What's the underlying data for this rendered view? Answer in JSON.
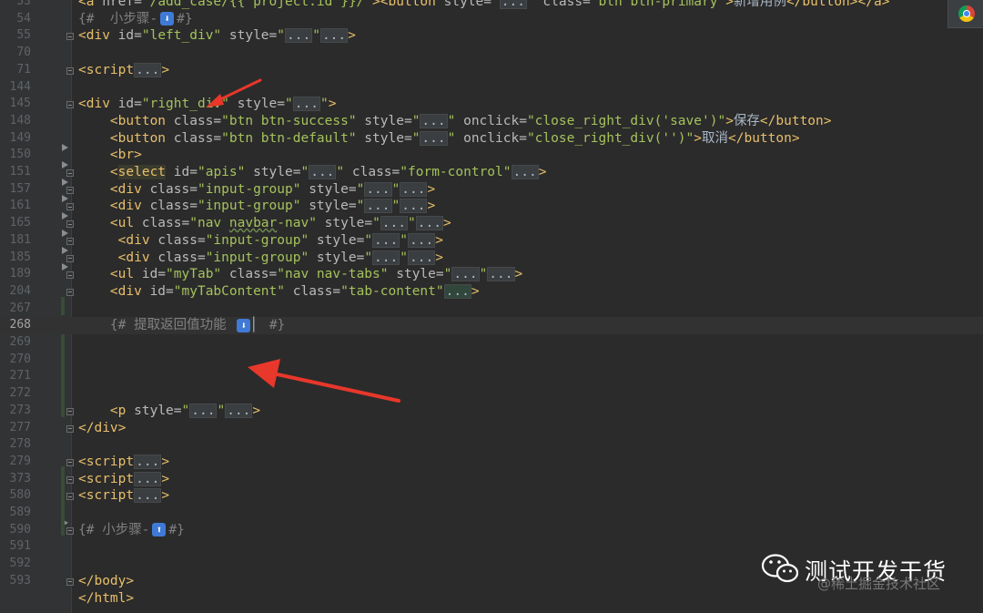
{
  "editor": {
    "colors": {
      "background": "#2b2b2b",
      "gutter": "#313335",
      "tag": "#e8bf6a",
      "string": "#a5c25c",
      "comment": "#808080",
      "change_bar": "#384c38"
    },
    "lines": [
      {
        "n": "53",
        "segments": [
          {
            "c": "tag",
            "t": "<a "
          },
          {
            "c": "attr",
            "t": "href="
          },
          {
            "c": "str",
            "t": "\"/add_case/{{ project.id }}/\""
          },
          {
            "c": "tag",
            "t": ">"
          },
          {
            "c": "tag",
            "t": "<button "
          },
          {
            "c": "attr",
            "t": "style="
          },
          {
            "c": "str",
            "t": "\""
          },
          {
            "c": "fold",
            "t": "..."
          },
          {
            "c": "str",
            "t": "\" "
          },
          {
            "c": "attr",
            "t": "class="
          },
          {
            "c": "str",
            "t": "\"btn btn-primary\""
          },
          {
            "c": "tag",
            "t": ">"
          },
          {
            "c": "txt",
            "t": "新增用例"
          },
          {
            "c": "tag",
            "t": "</button></a>"
          }
        ]
      },
      {
        "n": "54",
        "segments": [
          {
            "c": "cmt",
            "t": "{#  小步骤-"
          },
          {
            "c": "emoji",
            "t": "⬇"
          },
          {
            "c": "cmt",
            "t": "#}"
          }
        ]
      },
      {
        "n": "55",
        "segments": [
          {
            "c": "tag",
            "t": "<div "
          },
          {
            "c": "attr",
            "t": "id="
          },
          {
            "c": "str",
            "t": "\"left_div\" "
          },
          {
            "c": "attr",
            "t": "style="
          },
          {
            "c": "str",
            "t": "\""
          },
          {
            "c": "fold",
            "t": "..."
          },
          {
            "c": "str",
            "t": "\""
          },
          {
            "c": "fold-plain",
            "t": "..."
          },
          {
            "c": "tag",
            "t": ">"
          }
        ]
      },
      {
        "n": "70",
        "segments": []
      },
      {
        "n": "71",
        "segments": [
          {
            "c": "tag",
            "t": "<script"
          },
          {
            "c": "fold",
            "t": "..."
          },
          {
            "c": "tag",
            "t": ">"
          }
        ]
      },
      {
        "n": "144",
        "segments": []
      },
      {
        "n": "145",
        "segments": [
          {
            "c": "tag",
            "t": "<div "
          },
          {
            "c": "attr",
            "t": "id="
          },
          {
            "c": "str",
            "t": "\"right_div\" "
          },
          {
            "c": "attr",
            "t": "style="
          },
          {
            "c": "str",
            "t": "\""
          },
          {
            "c": "fold",
            "t": "..."
          },
          {
            "c": "str",
            "t": "\""
          },
          {
            "c": "tag",
            "t": ">"
          }
        ]
      },
      {
        "n": "148",
        "segments": [
          {
            "c": "txt",
            "t": "    "
          },
          {
            "c": "tag",
            "t": "<button "
          },
          {
            "c": "attr",
            "t": "class="
          },
          {
            "c": "str",
            "t": "\"btn btn-success\" "
          },
          {
            "c": "attr",
            "t": "style="
          },
          {
            "c": "str",
            "t": "\""
          },
          {
            "c": "fold",
            "t": "..."
          },
          {
            "c": "str",
            "t": "\" "
          },
          {
            "c": "attr",
            "t": "onclick="
          },
          {
            "c": "str",
            "t": "\"close_right_div('save')\""
          },
          {
            "c": "tag",
            "t": ">"
          },
          {
            "c": "txt",
            "t": "保存"
          },
          {
            "c": "tag",
            "t": "</button>"
          }
        ]
      },
      {
        "n": "149",
        "segments": [
          {
            "c": "txt",
            "t": "    "
          },
          {
            "c": "tag",
            "t": "<button "
          },
          {
            "c": "attr",
            "t": "class="
          },
          {
            "c": "str",
            "t": "\"btn btn-default\" "
          },
          {
            "c": "attr",
            "t": "style="
          },
          {
            "c": "str",
            "t": "\""
          },
          {
            "c": "fold",
            "t": "..."
          },
          {
            "c": "str",
            "t": "\" "
          },
          {
            "c": "attr",
            "t": "onclick="
          },
          {
            "c": "str",
            "t": "\"close_right_div('')\""
          },
          {
            "c": "tag",
            "t": ">"
          },
          {
            "c": "txt",
            "t": "取消"
          },
          {
            "c": "tag",
            "t": "</button>"
          }
        ]
      },
      {
        "n": "150",
        "segments": [
          {
            "c": "txt",
            "t": "    "
          },
          {
            "c": "tag",
            "t": "<br>"
          }
        ]
      },
      {
        "n": "151",
        "segments": [
          {
            "c": "txt",
            "t": "    "
          },
          {
            "c": "tag",
            "t": "<"
          },
          {
            "c": "tag-hl",
            "t": "select"
          },
          {
            "c": "tag",
            "t": " "
          },
          {
            "c": "attr",
            "t": "id="
          },
          {
            "c": "str",
            "t": "\"apis\" "
          },
          {
            "c": "attr",
            "t": "style="
          },
          {
            "c": "str",
            "t": "\""
          },
          {
            "c": "fold",
            "t": "..."
          },
          {
            "c": "str",
            "t": "\" "
          },
          {
            "c": "attr",
            "t": "class="
          },
          {
            "c": "str",
            "t": "\"form-control\""
          },
          {
            "c": "fold-plain",
            "t": "..."
          },
          {
            "c": "tag",
            "t": ">"
          }
        ]
      },
      {
        "n": "157",
        "segments": [
          {
            "c": "txt",
            "t": "    "
          },
          {
            "c": "tag",
            "t": "<div "
          },
          {
            "c": "attr",
            "t": "class="
          },
          {
            "c": "str",
            "t": "\"input-group\" "
          },
          {
            "c": "attr",
            "t": "style="
          },
          {
            "c": "str",
            "t": "\""
          },
          {
            "c": "fold",
            "t": "..."
          },
          {
            "c": "str",
            "t": "\""
          },
          {
            "c": "fold",
            "t": "..."
          },
          {
            "c": "tag",
            "t": ">"
          }
        ]
      },
      {
        "n": "161",
        "segments": [
          {
            "c": "txt",
            "t": "    "
          },
          {
            "c": "tag",
            "t": "<div "
          },
          {
            "c": "attr",
            "t": "class="
          },
          {
            "c": "str",
            "t": "\"input-group\" "
          },
          {
            "c": "attr",
            "t": "style="
          },
          {
            "c": "str",
            "t": "\""
          },
          {
            "c": "fold",
            "t": "..."
          },
          {
            "c": "str",
            "t": "\""
          },
          {
            "c": "fold",
            "t": "..."
          },
          {
            "c": "tag",
            "t": ">"
          }
        ]
      },
      {
        "n": "165",
        "segments": [
          {
            "c": "txt",
            "t": "    "
          },
          {
            "c": "tag",
            "t": "<ul "
          },
          {
            "c": "attr",
            "t": "class="
          },
          {
            "c": "str",
            "t": "\"nav "
          },
          {
            "c": "str-und",
            "t": "navbar"
          },
          {
            "c": "str",
            "t": "-nav\" "
          },
          {
            "c": "attr",
            "t": "style="
          },
          {
            "c": "str",
            "t": "\""
          },
          {
            "c": "fold",
            "t": "..."
          },
          {
            "c": "str",
            "t": "\""
          },
          {
            "c": "fold",
            "t": "..."
          },
          {
            "c": "tag",
            "t": ">"
          }
        ]
      },
      {
        "n": "181",
        "segments": [
          {
            "c": "txt",
            "t": "     "
          },
          {
            "c": "tag",
            "t": "<div "
          },
          {
            "c": "attr",
            "t": "class="
          },
          {
            "c": "str",
            "t": "\"input-group\" "
          },
          {
            "c": "attr",
            "t": "style="
          },
          {
            "c": "str",
            "t": "\""
          },
          {
            "c": "fold",
            "t": "..."
          },
          {
            "c": "str",
            "t": "\""
          },
          {
            "c": "fold",
            "t": "..."
          },
          {
            "c": "tag",
            "t": ">"
          }
        ]
      },
      {
        "n": "185",
        "segments": [
          {
            "c": "txt",
            "t": "     "
          },
          {
            "c": "tag",
            "t": "<div "
          },
          {
            "c": "attr",
            "t": "class="
          },
          {
            "c": "str",
            "t": "\"input-group\" "
          },
          {
            "c": "attr",
            "t": "style="
          },
          {
            "c": "str",
            "t": "\""
          },
          {
            "c": "fold",
            "t": "..."
          },
          {
            "c": "str",
            "t": "\""
          },
          {
            "c": "fold",
            "t": "..."
          },
          {
            "c": "tag",
            "t": ">"
          }
        ]
      },
      {
        "n": "189",
        "segments": [
          {
            "c": "txt",
            "t": "    "
          },
          {
            "c": "tag",
            "t": "<ul "
          },
          {
            "c": "attr",
            "t": "id="
          },
          {
            "c": "str",
            "t": "\"myTab\" "
          },
          {
            "c": "attr",
            "t": "class="
          },
          {
            "c": "str",
            "t": "\"nav nav-tabs\" "
          },
          {
            "c": "attr",
            "t": "style="
          },
          {
            "c": "str",
            "t": "\""
          },
          {
            "c": "fold",
            "t": "..."
          },
          {
            "c": "str",
            "t": "\""
          },
          {
            "c": "fold-plain",
            "t": "..."
          },
          {
            "c": "tag",
            "t": ">"
          }
        ]
      },
      {
        "n": "204",
        "segments": [
          {
            "c": "txt",
            "t": "    "
          },
          {
            "c": "tag",
            "t": "<div "
          },
          {
            "c": "attr",
            "t": "id="
          },
          {
            "c": "str",
            "t": "\"myTabContent\" "
          },
          {
            "c": "attr",
            "t": "class="
          },
          {
            "c": "str",
            "t": "\"tab-content\""
          },
          {
            "c": "fold-green",
            "t": "..."
          },
          {
            "c": "tag",
            "t": ">"
          }
        ]
      },
      {
        "n": "267",
        "segments": []
      },
      {
        "n": "268",
        "current": true,
        "segments": [
          {
            "c": "txt",
            "t": "    "
          },
          {
            "c": "cmt",
            "t": "{# 提取返回值功能 "
          },
          {
            "c": "emoji",
            "t": "⬇"
          },
          {
            "c": "txt",
            "t": "▏ "
          },
          {
            "c": "cmt",
            "t": "#}"
          }
        ]
      },
      {
        "n": "269",
        "segments": []
      },
      {
        "n": "270",
        "segments": []
      },
      {
        "n": "271",
        "segments": []
      },
      {
        "n": "272",
        "segments": []
      },
      {
        "n": "273",
        "segments": [
          {
            "c": "txt",
            "t": "    "
          },
          {
            "c": "tag",
            "t": "<p "
          },
          {
            "c": "attr",
            "t": "style="
          },
          {
            "c": "str",
            "t": "\""
          },
          {
            "c": "fold",
            "t": "..."
          },
          {
            "c": "str",
            "t": "\""
          },
          {
            "c": "fold-plain",
            "t": "..."
          },
          {
            "c": "tag",
            "t": ">"
          }
        ]
      },
      {
        "n": "277",
        "segments": [
          {
            "c": "tag",
            "t": "</div>"
          }
        ]
      },
      {
        "n": "278",
        "segments": []
      },
      {
        "n": "279",
        "segments": [
          {
            "c": "tag",
            "t": "<script"
          },
          {
            "c": "fold",
            "t": "..."
          },
          {
            "c": "tag",
            "t": ">"
          }
        ]
      },
      {
        "n": "373",
        "segments": [
          {
            "c": "tag",
            "t": "<script"
          },
          {
            "c": "fold",
            "t": "..."
          },
          {
            "c": "tag",
            "t": ">"
          }
        ]
      },
      {
        "n": "580",
        "segments": [
          {
            "c": "tag",
            "t": "<script"
          },
          {
            "c": "fold",
            "t": "..."
          },
          {
            "c": "tag",
            "t": ">"
          }
        ]
      },
      {
        "n": "589",
        "segments": []
      },
      {
        "n": "590",
        "segments": [
          {
            "c": "cmt",
            "t": "{# 小步骤-"
          },
          {
            "c": "emoji",
            "t": "⬆"
          },
          {
            "c": "cmt",
            "t": "#}"
          }
        ]
      },
      {
        "n": "591",
        "segments": []
      },
      {
        "n": "592",
        "segments": []
      },
      {
        "n": "593",
        "segments": [
          {
            "c": "tag",
            "t": "</body>"
          }
        ]
      },
      {
        "n": "",
        "segments": [
          {
            "c": "tag",
            "t": "</html>"
          }
        ]
      }
    ]
  },
  "toolbar": {
    "browser_icon": "chrome-icon"
  },
  "annotations": {
    "arrow_color": "#e8372b"
  },
  "watermark": {
    "title": "测试开发干货",
    "subtitle": "@稀土掘金技术社区",
    "logo_icon": "wechat-icon"
  }
}
